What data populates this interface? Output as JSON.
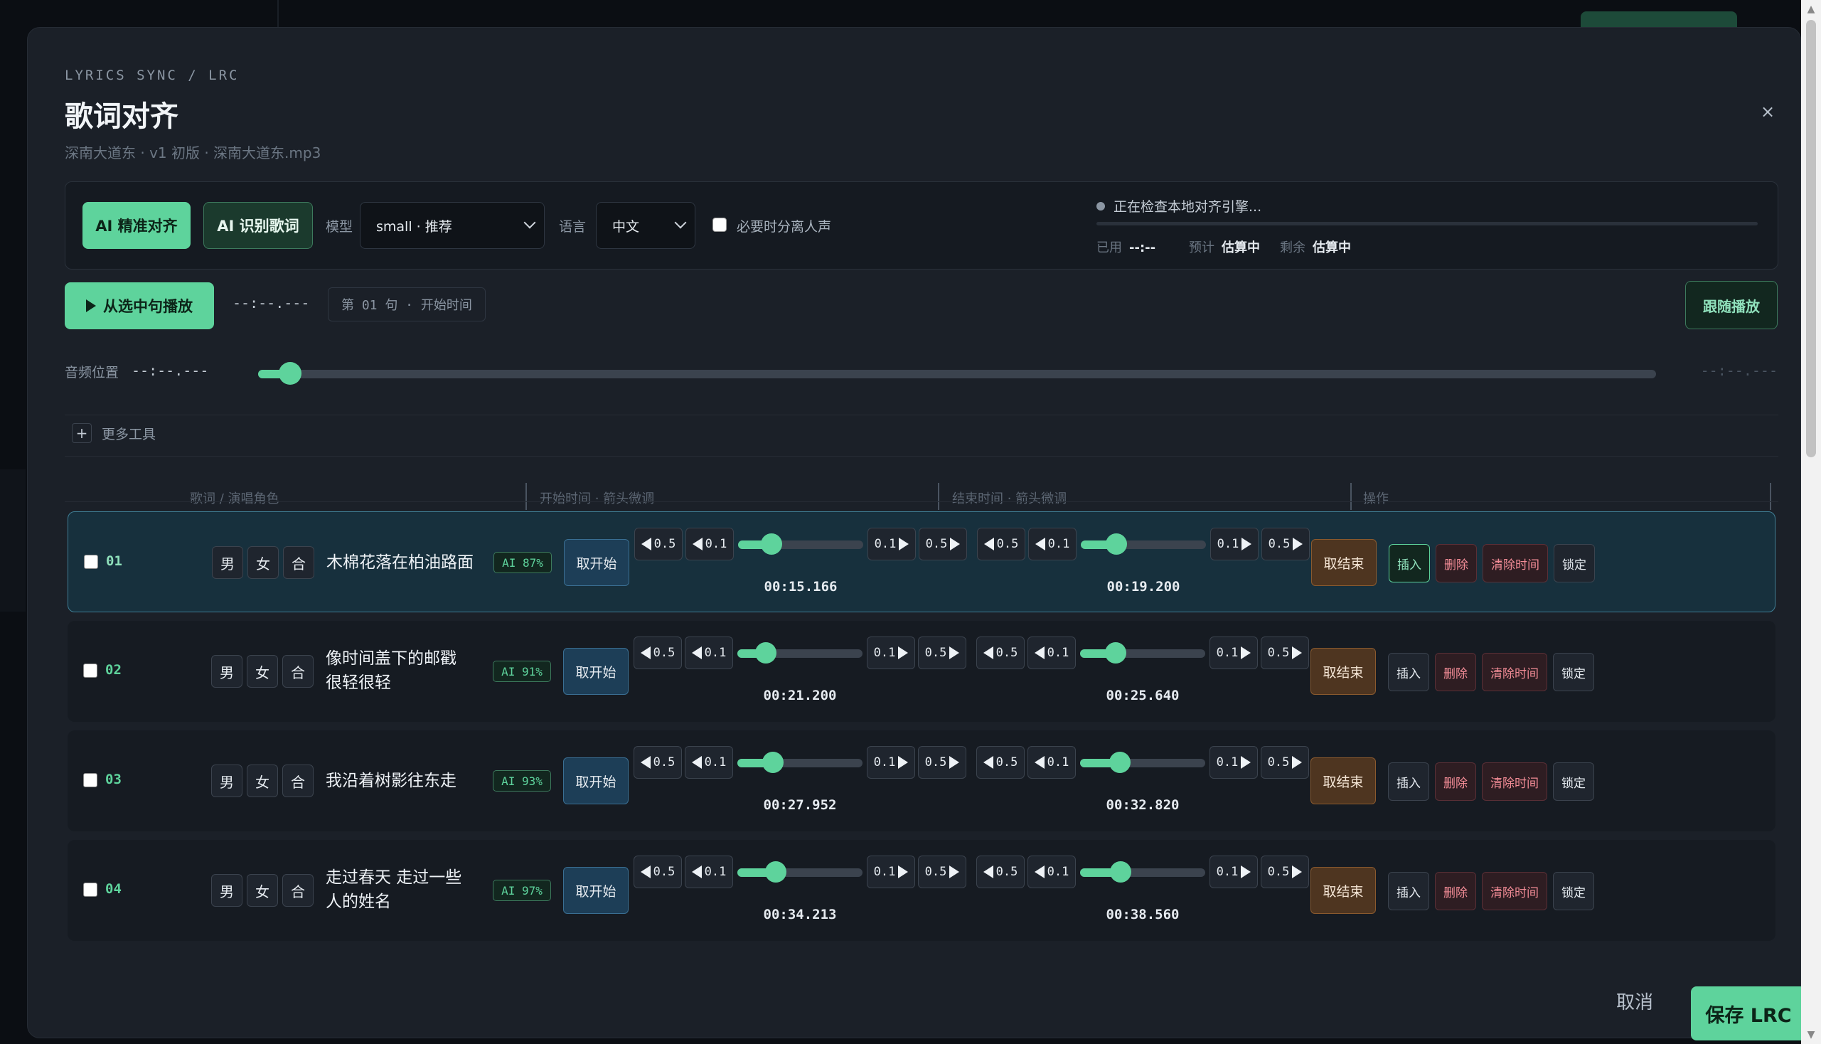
{
  "header": {
    "breadcrumb": "LYRICS SYNC / LRC",
    "title": "歌词对齐",
    "subtitle": "深南大道东 · v1 初版 · 深南大道东.mp3",
    "close_label": "×"
  },
  "toolbar": {
    "ai_align_label": "AI 精准对齐",
    "ai_recognize_label": "AI 识别歌词",
    "model_label": "模型",
    "model_value": "small · 推荐",
    "language_label": "语言",
    "language_value": "中文",
    "separate_vocals_label": "必要时分离人声",
    "status_text": "正在检查本地对齐引擎...",
    "used_label": "已用",
    "used_value": "--:--",
    "estimate_label": "预计",
    "estimate_value": "估算中",
    "remaining_label": "剩余",
    "remaining_value": "估算中"
  },
  "playback": {
    "play_label": "从选中句播放",
    "current_time": "--:--.---",
    "sentence_badge": "第 01 句 · 开始时间",
    "follow_label": "跟随播放"
  },
  "audio": {
    "label": "音频位置",
    "time": "--:--.---",
    "end_time": "--:--.---",
    "position": 0.015
  },
  "more_tools_label": "更多工具",
  "table": {
    "col_lyric": "歌词 / 演唱角色",
    "col_start": "开始时间 · 箭头微调",
    "col_end": "结束时间 · 箭头微调",
    "col_ops": "操作"
  },
  "row_labels": {
    "male": "男",
    "female": "女",
    "together": "合",
    "take_start": "取开始",
    "take_end": "取结束",
    "nudge_05": "0.5",
    "nudge_01": "0.1",
    "insert": "插入",
    "delete": "删除",
    "clear_time": "清除时间",
    "lock": "锁定"
  },
  "rows": [
    {
      "num": "01",
      "lyric": "木棉花落在柏油路面",
      "ai": "AI 87%",
      "start": "00:15.166",
      "end": "00:19.200",
      "start_pos": 0.22,
      "end_pos": 0.24
    },
    {
      "num": "02",
      "lyric": "像时间盖下的邮戳 很轻很轻",
      "ai": "AI 91%",
      "start": "00:21.200",
      "end": "00:25.640",
      "start_pos": 0.17,
      "end_pos": 0.24
    },
    {
      "num": "03",
      "lyric": "我沿着树影往东走",
      "ai": "AI 93%",
      "start": "00:27.952",
      "end": "00:32.820",
      "start_pos": 0.24,
      "end_pos": 0.28
    },
    {
      "num": "04",
      "lyric": "走过春天 走过一些人的姓名",
      "ai": "AI 97%",
      "start": "00:34.213",
      "end": "00:38.560",
      "start_pos": 0.27,
      "end_pos": 0.29
    }
  ],
  "footer": {
    "cancel_label": "取消",
    "save_label": "保存 LRC"
  },
  "colors": {
    "accent": "#5ed39c",
    "panel": "#1b2028",
    "danger": "#f28c96"
  }
}
